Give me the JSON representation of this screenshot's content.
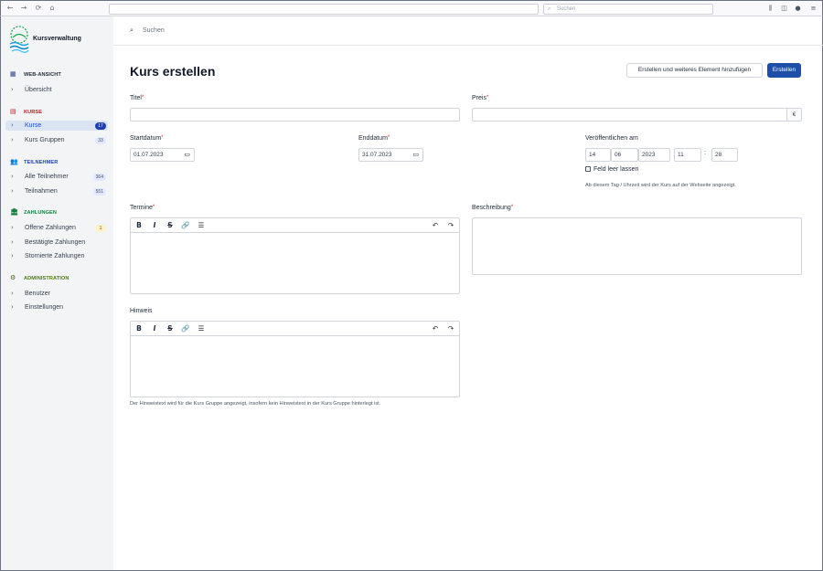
{
  "browser": {
    "back_icon": "←",
    "forward_icon": "→",
    "reload_icon": "⟳",
    "home_icon": "⌂",
    "search_placeholder": "Suchen",
    "toolbar_icons": [
      "library-icon",
      "sidebar-icon",
      "account-icon",
      "menu-icon"
    ]
  },
  "sidebar": {
    "brand": "Kursverwaltung",
    "groups": [
      {
        "title": "WEB-ANSICHT",
        "color": "#1f2937",
        "icon": "calendar-icon",
        "items": [
          {
            "label": "Übersicht"
          }
        ]
      },
      {
        "title": "KURSE",
        "color": "#b91c1c",
        "icon": "table-icon",
        "items": [
          {
            "label": "Kurse",
            "count": "17",
            "active": true
          },
          {
            "label": "Kurs Gruppen",
            "count": "33"
          }
        ]
      },
      {
        "title": "TEILNEHMER",
        "color": "#1e40af",
        "icon": "users-icon",
        "items": [
          {
            "label": "Alle Teilnehmer",
            "count": "364"
          },
          {
            "label": "Teilnahmen",
            "count": "551"
          }
        ]
      },
      {
        "title": "ZAHLUNGEN",
        "color": "#15803d",
        "icon": "bank-icon",
        "items": [
          {
            "label": "Offene Zahlungen",
            "count": "1"
          },
          {
            "label": "Bestätigte Zahlungen"
          },
          {
            "label": "Stornierte Zahlungen"
          }
        ]
      },
      {
        "title": "ADMINISTRATION",
        "color": "#4d7c0f",
        "icon": "gear-icon",
        "items": [
          {
            "label": "Benutzer"
          },
          {
            "label": "Einstellungen"
          }
        ]
      }
    ]
  },
  "topbar": {
    "search_placeholder": "Suchen"
  },
  "page": {
    "title": "Kurs erstellen",
    "create_another_label": "Erstellen und weiteres Element hinzufügen",
    "create_label": "Erstellen"
  },
  "form": {
    "titel_label": "Titel",
    "preis_label": "Preis",
    "currency": "€",
    "startdatum_label": "Startdatum",
    "startdatum_value": "01.07.2023",
    "enddatum_label": "Enddatum",
    "enddatum_value": "31.07.2023",
    "publish_label": "Veröffentlichen am",
    "publish_day": "14",
    "publish_month": "06",
    "publish_year": "2023",
    "publish_hour": "11",
    "publish_minute": "28",
    "empty_label": "Feld leer lassen",
    "publish_help": "Ab diesem Tag / Uhrzeit wird der Kurs auf der Webseite angezeigt.",
    "termine_label": "Termine",
    "beschreibung_label": "Beschreibung",
    "hinweis_label": "Hinweis",
    "hinweis_help": "Der Hinweistext wird für die Kurs Gruppe angezeigt, insofern kein Hinweistext in der Kurs Gruppe hinterlegt ist.",
    "required_mark": "*"
  },
  "editor_toolbar": {
    "bold": "B",
    "italic": "I",
    "strike": "S",
    "link": "🔗",
    "list": "☰",
    "undo": "↶",
    "redo": "↷"
  }
}
